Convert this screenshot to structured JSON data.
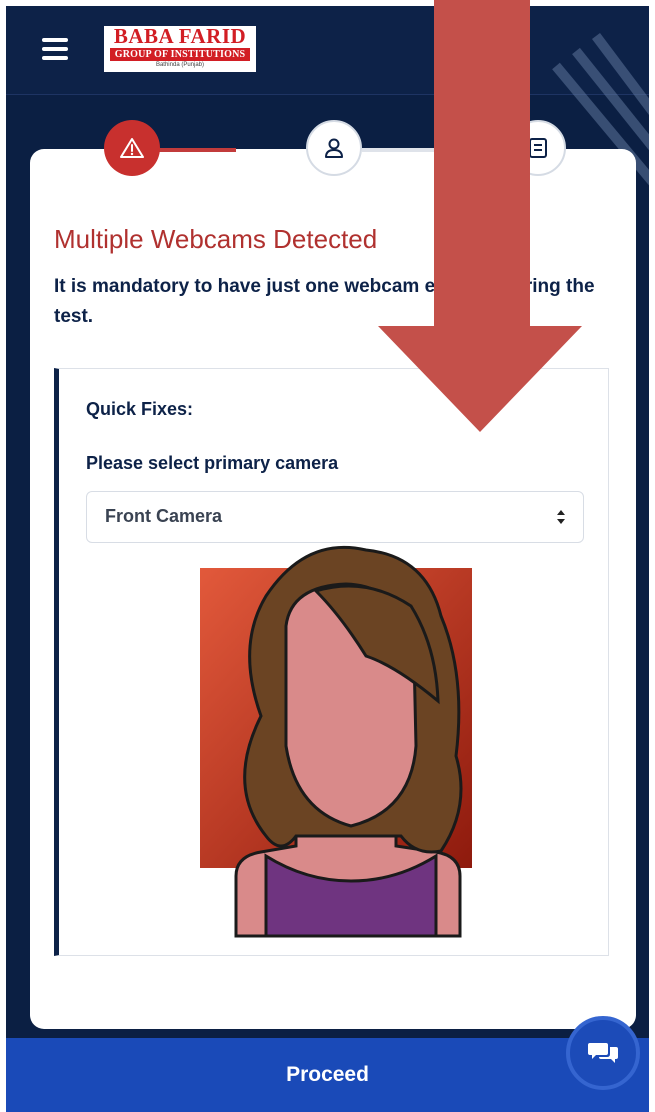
{
  "header": {
    "logo": {
      "line1": "BABA FARID",
      "line2": "GROUP OF INSTITUTIONS",
      "line3": "Bathinda (Punjab)"
    }
  },
  "stepper": {
    "steps": [
      {
        "icon": "warning-icon",
        "state": "active"
      },
      {
        "icon": "user-icon",
        "state": "inactive"
      },
      {
        "icon": "id-card-icon",
        "state": "inactive"
      }
    ]
  },
  "main": {
    "title": "Multiple Webcams Detected",
    "description": "It is mandatory to have just one webcam enabled during the test.",
    "quick_fixes": {
      "heading": "Quick Fixes:",
      "select_label": "Please select primary camera",
      "selected_camera": "Front Camera"
    }
  },
  "footer": {
    "proceed_label": "Proceed"
  },
  "colors": {
    "navy": "#0b1f43",
    "accent_red": "#c8302e",
    "title_red": "#b0312f",
    "proceed_blue": "#1a4ab8",
    "overlay_arrow": "#c4504a"
  }
}
